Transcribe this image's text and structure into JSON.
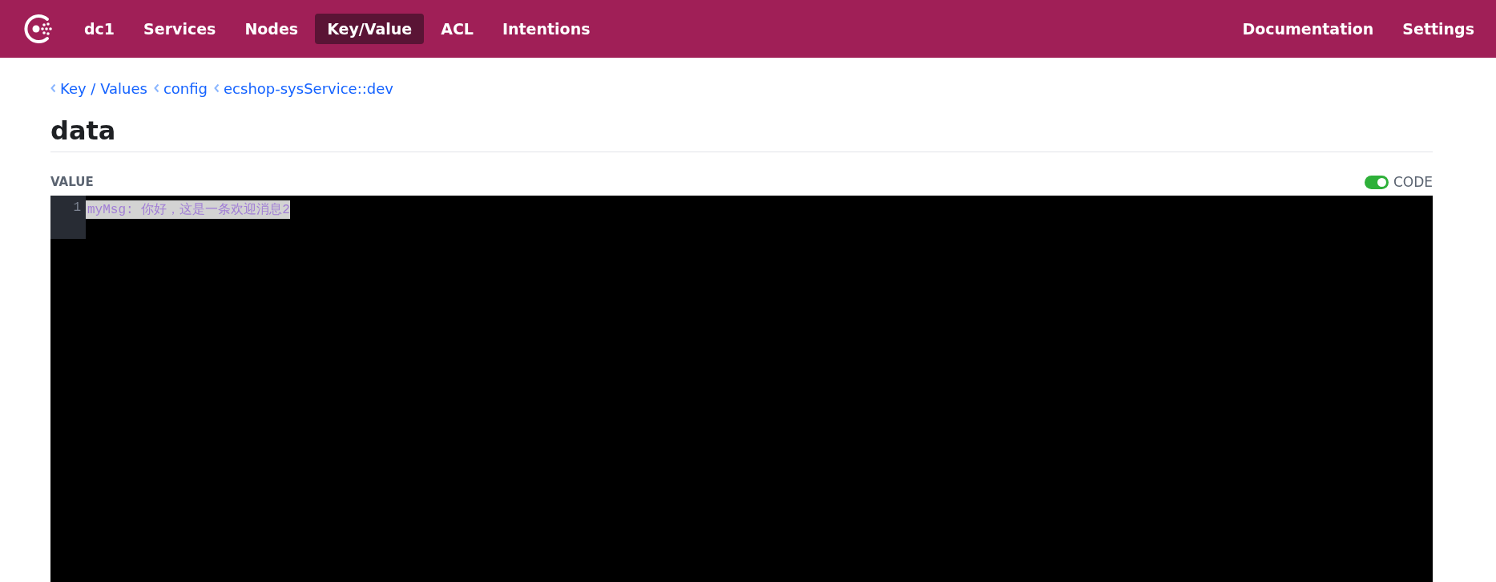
{
  "nav": {
    "items": [
      {
        "label": "dc1",
        "selected": false
      },
      {
        "label": "Services",
        "selected": false
      },
      {
        "label": "Nodes",
        "selected": false
      },
      {
        "label": "Key/Value",
        "selected": true
      },
      {
        "label": "ACL",
        "selected": false
      },
      {
        "label": "Intentions",
        "selected": false
      }
    ],
    "right_items": [
      "Documentation",
      "Settings"
    ]
  },
  "breadcrumbs": [
    "Key / Values",
    "config",
    "ecshop-sysService::dev"
  ],
  "title": "data",
  "value_label": "VALUE",
  "code_toggle": {
    "label": "CODE",
    "on": true
  },
  "editor": {
    "lines": [
      {
        "number": "1",
        "text": "myMsg: 你好，这是一条欢迎消息2",
        "selected": true
      }
    ]
  }
}
